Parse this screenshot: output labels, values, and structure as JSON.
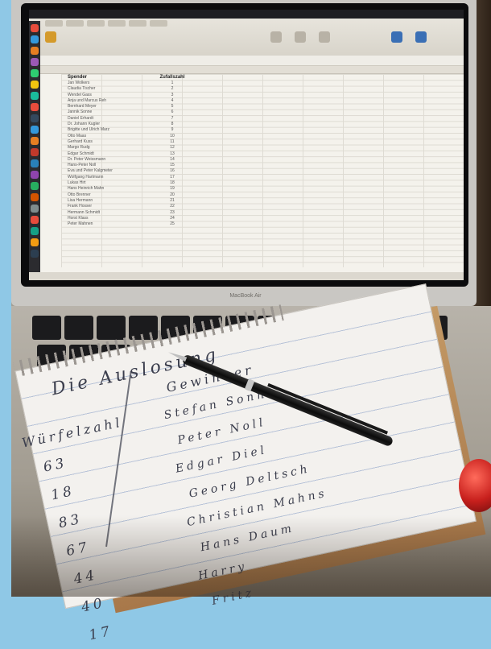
{
  "spreadsheet": {
    "header_spender": "Spender",
    "header_zufallszahl": "Zufallszahl",
    "rows": [
      {
        "name": "Jan Wolkers",
        "zahl": "1"
      },
      {
        "name": "Claudia Tischer",
        "zahl": "2"
      },
      {
        "name": "Wendel Gass",
        "zahl": "3"
      },
      {
        "name": "Anja und Marcus Reh",
        "zahl": "4"
      },
      {
        "name": "Bernhard Meyer",
        "zahl": "5"
      },
      {
        "name": "Jannik Sonne",
        "zahl": "6"
      },
      {
        "name": "Daniel Erhardt",
        "zahl": "7"
      },
      {
        "name": "Dr. Johann Kugler",
        "zahl": "8"
      },
      {
        "name": "Brigitte und Ulrich Marz",
        "zahl": "9"
      },
      {
        "name": "Otto Maas",
        "zahl": "10"
      },
      {
        "name": "Gerhard Kuss",
        "zahl": "11"
      },
      {
        "name": "Margo Rudg",
        "zahl": "12"
      },
      {
        "name": "Edgar Schmidt",
        "zahl": "13"
      },
      {
        "name": "Dr. Peter Weissmann",
        "zahl": "14"
      },
      {
        "name": "Hans-Peter Noll",
        "zahl": "15"
      },
      {
        "name": "Eva und Peter Kalgmeter",
        "zahl": "16"
      },
      {
        "name": "Wolfgang Hartmann",
        "zahl": "17"
      },
      {
        "name": "Lukas Hirt",
        "zahl": "18"
      },
      {
        "name": "Hans Heinrich Mahn",
        "zahl": "19"
      },
      {
        "name": "Otto Brenner",
        "zahl": "20"
      },
      {
        "name": "Lisa Hermann",
        "zahl": "21"
      },
      {
        "name": "Frank Hosser",
        "zahl": "22"
      },
      {
        "name": "Hermann Schmidt",
        "zahl": "23"
      },
      {
        "name": "Horst Klass",
        "zahl": "24"
      },
      {
        "name": "Peter Mahnen",
        "zahl": "25"
      }
    ]
  },
  "laptop_brand": "MacBook Air",
  "notepad": {
    "title": "Die Auslosung",
    "col_left_header": "Würfelzahl",
    "col_right_header": "Gewinner",
    "numbers": [
      "63",
      "18",
      "83",
      "67",
      "44",
      "40",
      "17"
    ],
    "winners": [
      "Stefan Sonne",
      "Peter Noll",
      "Edgar Diel",
      "Georg Deltsch",
      "Christian Mahns",
      "Hans Daum",
      "Harry",
      "Fritz"
    ]
  },
  "colors": {
    "frame_blue": "#8fc8e6",
    "ink": "#3b3e4d",
    "die_red": "#c8201d"
  }
}
